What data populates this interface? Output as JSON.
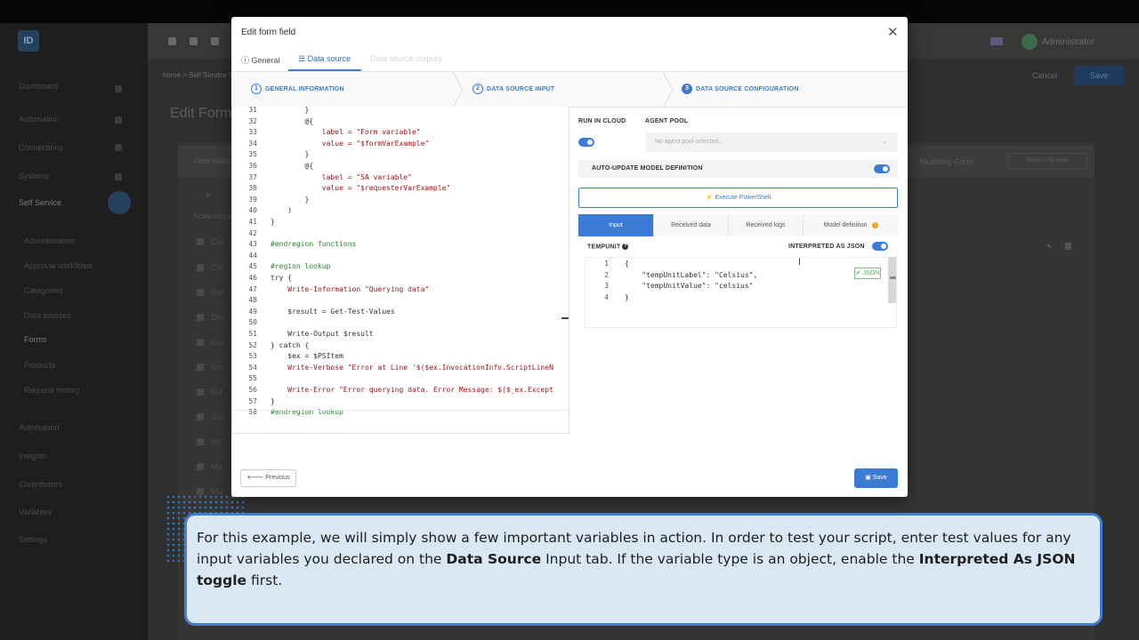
{
  "background_app": {
    "logo": "ID",
    "nav": [
      "Dashboard",
      "Automation",
      "Connections",
      "Systems",
      "Self Service",
      "Administration",
      "Approval workflows",
      "Categories",
      "Data sources",
      "Forms",
      "Products",
      "Request history",
      "Automation",
      "Insights",
      "Contributors",
      "Variables",
      "Settings"
    ],
    "header": {
      "breadcrumb": "home  >  Self Service  >  Forms",
      "user": "Administrator",
      "cancel": "Cancel",
      "save": "Save"
    },
    "page_title": "Edit Form",
    "toolbar": {
      "form_name_label": "Form Name",
      "multistep": "Multistep Form",
      "readonly": "Read-only data"
    },
    "form_fields_label": "FORM FIELDS",
    "rows": [
      "Cre",
      "Col",
      "Dat",
      "Dro",
      "Gui",
      "Em",
      "Fol",
      "Gro",
      "He",
      "Ma",
      "Mu"
    ]
  },
  "modal": {
    "title": "Edit form field",
    "close_icon": "close-icon",
    "tabs": [
      {
        "label": "General",
        "icon": "info-icon"
      },
      {
        "label": "Data source",
        "icon": "database-icon"
      },
      {
        "label": "Data source outputs"
      }
    ],
    "steps": [
      {
        "num": "1",
        "label": "GENERAL INFORMATION"
      },
      {
        "num": "2",
        "label": "DATA SOURCE INPUT"
      },
      {
        "num": "3",
        "label": "DATA SOURCE CONFIGURATION"
      }
    ],
    "code_lines": [
      {
        "n": "31",
        "t": "        }"
      },
      {
        "n": "32",
        "t": "        @{"
      },
      {
        "n": "33",
        "t": "            label = \"Form variable\""
      },
      {
        "n": "34",
        "t": "            value = \"$formVarExample\""
      },
      {
        "n": "35",
        "t": "        }"
      },
      {
        "n": "36",
        "t": "        @{"
      },
      {
        "n": "37",
        "t": "            label = \"SA variable\""
      },
      {
        "n": "38",
        "t": "            value = \"$requesterVarExample\""
      },
      {
        "n": "39",
        "t": "        }"
      },
      {
        "n": "40",
        "t": "    )"
      },
      {
        "n": "41",
        "t": "}"
      },
      {
        "n": "42",
        "t": ""
      },
      {
        "n": "43",
        "t": "#endregion functions"
      },
      {
        "n": "44",
        "t": ""
      },
      {
        "n": "45",
        "t": "#region lookup"
      },
      {
        "n": "46",
        "t": "try {"
      },
      {
        "n": "47",
        "t": "    Write-Information \"Querying data\""
      },
      {
        "n": "48",
        "t": ""
      },
      {
        "n": "49",
        "t": "    $result = Get-Test-Values"
      },
      {
        "n": "50",
        "t": ""
      },
      {
        "n": "51",
        "t": "    Write-Output $result"
      },
      {
        "n": "52",
        "t": "} catch {"
      },
      {
        "n": "53",
        "t": "    $ex = $PSItem"
      },
      {
        "n": "54",
        "t": "    Write-Verbose \"Error at Line '$($ex.InvocationInfo.ScriptLineN"
      },
      {
        "n": "55",
        "t": ""
      },
      {
        "n": "56",
        "t": "    Write-Error \"Error querying data. Error Message: $($_ex.Except"
      },
      {
        "n": "57",
        "t": "}"
      },
      {
        "n": "58",
        "t": "#endregion lookup"
      }
    ],
    "run_in_cloud_label": "RUN IN CLOUD",
    "run_in_cloud": true,
    "agent_pool_label": "AGENT POOL",
    "agent_pool_placeholder": "No agent pool selected...",
    "auto_update_label": "AUTO-UPDATE MODEL DEFINITION",
    "auto_update": true,
    "execute_button": "Execute PowerShell",
    "right_tabs": [
      "Input",
      "Received data",
      "Received logs",
      "Model definition"
    ],
    "tempunit_label": "TEMPUNIT",
    "interpreted_json_label": "INTERPRETED AS JSON",
    "interpreted_json": true,
    "json_lines": [
      {
        "n": "1",
        "t": "{"
      },
      {
        "n": "2",
        "t": "    \"tempUnitLabel\": \"Celsius\","
      },
      {
        "n": "3",
        "t": "    \"tempUnitValue\": \"celsius\""
      },
      {
        "n": "4",
        "t": "}"
      }
    ],
    "json_badge": "JSON",
    "previous_button": "Previous",
    "save_button": "Save"
  },
  "caption": {
    "part1": "For this example, we will simply show a few important variables in action. In order to test your script, enter test values for any input variables you declared on the ",
    "bold1": "Data Source",
    "part2": " Input tab. If the variable type is an object, enable the ",
    "bold2": "Interpreted As JSON toggle",
    "part3": " first."
  },
  "colors": {
    "accent": "#3a7bd5",
    "caption_bg": "#dae7f4",
    "caption_border": "#3e7fd1"
  }
}
